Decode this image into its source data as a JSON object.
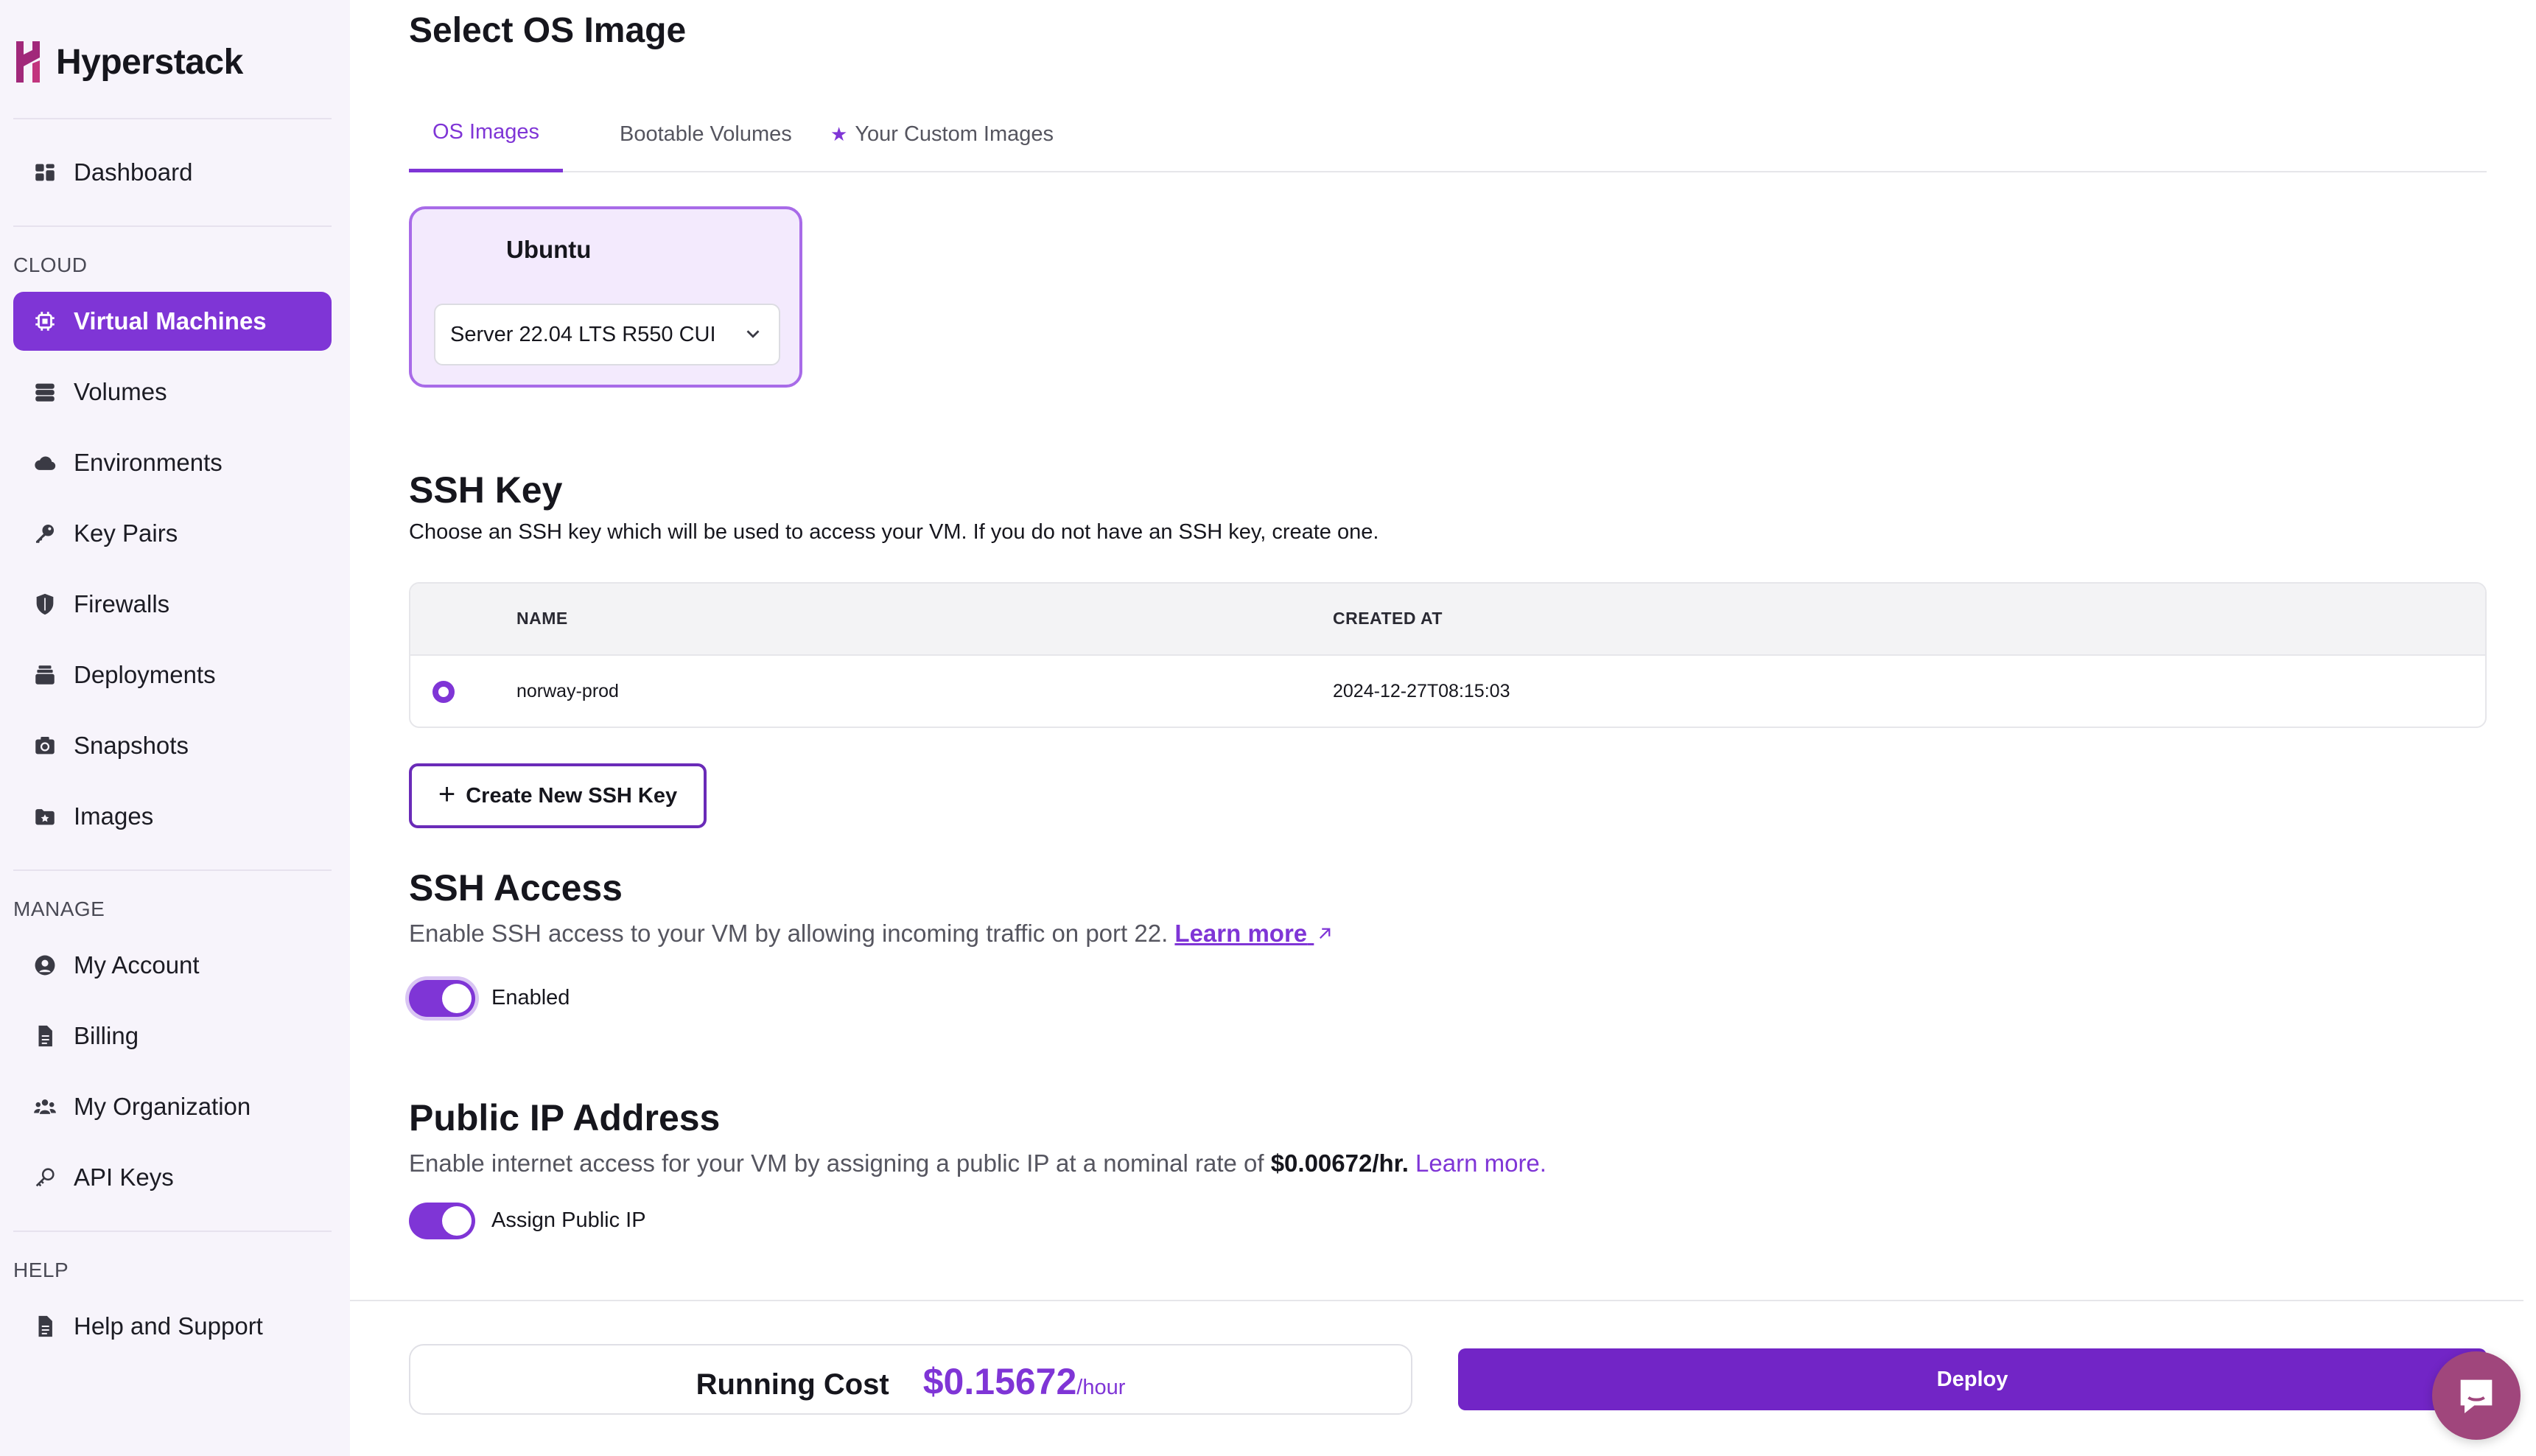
{
  "brand": {
    "name": "Hyperstack"
  },
  "sidebar": {
    "items_top": [
      {
        "label": "Dashboard",
        "icon": "dashboard-icon"
      }
    ],
    "sections": [
      {
        "label": "CLOUD",
        "items": [
          {
            "label": "Virtual Machines",
            "icon": "chip-icon",
            "active": true
          },
          {
            "label": "Volumes",
            "icon": "database-icon"
          },
          {
            "label": "Environments",
            "icon": "cloud-icon"
          },
          {
            "label": "Key Pairs",
            "icon": "key-icon"
          },
          {
            "label": "Firewalls",
            "icon": "shield-icon"
          },
          {
            "label": "Deployments",
            "icon": "layers-icon"
          },
          {
            "label": "Snapshots",
            "icon": "camera-icon"
          },
          {
            "label": "Images",
            "icon": "image-icon"
          }
        ]
      },
      {
        "label": "MANAGE",
        "items": [
          {
            "label": "My Account",
            "icon": "user-circle-icon"
          },
          {
            "label": "Billing",
            "icon": "document-icon"
          },
          {
            "label": "My Organization",
            "icon": "users-icon"
          },
          {
            "label": "API Keys",
            "icon": "api-key-icon"
          }
        ]
      },
      {
        "label": "HELP",
        "items": [
          {
            "label": "Help and Support",
            "icon": "help-document-icon"
          }
        ]
      }
    ]
  },
  "main": {
    "title": "Select OS Image",
    "tabs": [
      {
        "label": "OS Images",
        "active": true
      },
      {
        "label": "Bootable Volumes"
      },
      {
        "label": "Your Custom Images",
        "icon": "star-icon"
      }
    ],
    "os_card": {
      "title": "Ubuntu",
      "selected_value": "Server 22.04 LTS R550 CUI"
    },
    "ssh_key": {
      "title": "SSH Key",
      "description": "Choose an SSH key which will be used to access your VM. If you do not have an SSH key, create one.",
      "columns": [
        "NAME",
        "CREATED AT"
      ],
      "rows": [
        {
          "name": "norway-prod",
          "created_at": "2024-12-27T08:15:03",
          "selected": true
        }
      ],
      "create_button": "Create New SSH Key"
    },
    "ssh_access": {
      "title": "SSH Access",
      "description": "Enable SSH access to your VM by allowing incoming traffic on port 22.",
      "link": "Learn more",
      "toggle_label": "Enabled",
      "enabled": true
    },
    "public_ip": {
      "title": "Public IP Address",
      "description": "Enable internet access for your VM by assigning a public IP at a nominal rate of",
      "rate": "$0.00672/hr.",
      "link": "Learn more.",
      "toggle_label": "Assign Public IP",
      "enabled": true
    }
  },
  "footer": {
    "cost_label": "Running Cost",
    "cost_value": "$0.15672",
    "cost_unit": "/hour",
    "deploy_label": "Deploy"
  },
  "colors": {
    "accent": "#7f35d6",
    "deploy": "#7225c6",
    "sidebar_bg": "#f7f4fb",
    "card_bg": "#f3eafd"
  }
}
